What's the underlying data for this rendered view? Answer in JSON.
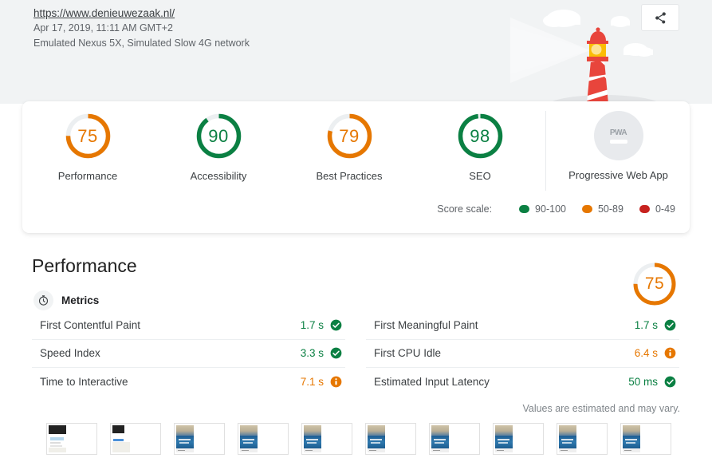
{
  "header": {
    "url": "https://www.denieuwezaak.nl/",
    "timestamp": "Apr 17, 2019, 11:11 AM GMT+2",
    "environment": "Emulated Nexus 5X, Simulated Slow 4G network",
    "share_icon": "share-icon"
  },
  "scores": {
    "categories": [
      {
        "label": "Performance",
        "value": "75",
        "score": 75,
        "color": "#e67700",
        "rating": "average"
      },
      {
        "label": "Accessibility",
        "value": "90",
        "score": 90,
        "color": "#0b8043",
        "rating": "pass"
      },
      {
        "label": "Best Practices",
        "value": "79",
        "score": 79,
        "color": "#e67700",
        "rating": "average"
      },
      {
        "label": "SEO",
        "value": "98",
        "score": 98,
        "color": "#0b8043",
        "rating": "pass"
      }
    ],
    "pwa": {
      "label": "Progressive Web App",
      "badge_text": "PWA",
      "state": "not-applicable"
    },
    "scale": {
      "label": "Score scale:",
      "items": [
        {
          "range": "90-100",
          "color": "#0b8043"
        },
        {
          "range": "50-89",
          "color": "#e67700"
        },
        {
          "range": "0-49",
          "color": "#c7221f"
        }
      ]
    }
  },
  "performance": {
    "title": "Performance",
    "gauge": {
      "value": "75",
      "score": 75,
      "color": "#e67700"
    },
    "metrics_header": {
      "label": "Metrics",
      "icon": "stopwatch-icon"
    },
    "metrics_left": [
      {
        "name": "First Contentful Paint",
        "value": "1.7 s",
        "rating": "pass",
        "icon": "check-circle-icon"
      },
      {
        "name": "Speed Index",
        "value": "3.3 s",
        "rating": "pass",
        "icon": "check-circle-icon"
      },
      {
        "name": "Time to Interactive",
        "value": "7.1 s",
        "rating": "average",
        "icon": "info-circle-icon"
      }
    ],
    "metrics_right": [
      {
        "name": "First Meaningful Paint",
        "value": "1.7 s",
        "rating": "pass",
        "icon": "check-circle-icon"
      },
      {
        "name": "First CPU Idle",
        "value": "6.4 s",
        "rating": "average",
        "icon": "info-circle-icon"
      },
      {
        "name": "Estimated Input Latency",
        "value": "50 ms",
        "rating": "pass",
        "icon": "check-circle-icon"
      }
    ],
    "note": "Values are estimated and may vary.",
    "filmstrip": [
      {
        "kind": "dark"
      },
      {
        "kind": "blank"
      },
      {
        "kind": "photo"
      },
      {
        "kind": "photo"
      },
      {
        "kind": "photo"
      },
      {
        "kind": "photo"
      },
      {
        "kind": "photo"
      },
      {
        "kind": "photo"
      },
      {
        "kind": "photo"
      },
      {
        "kind": "photo"
      }
    ]
  }
}
